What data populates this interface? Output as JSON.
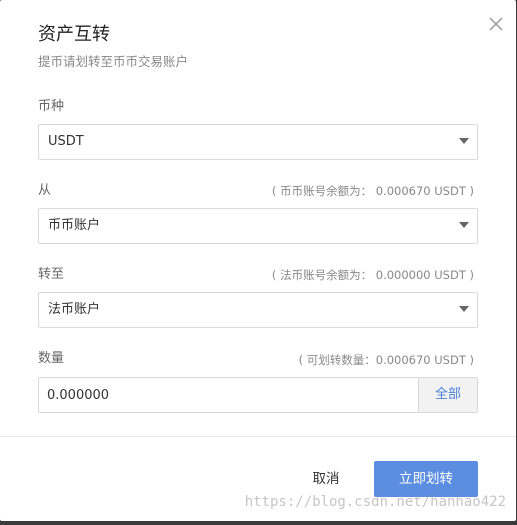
{
  "dialog": {
    "title": "资产互转",
    "subtitle": "提币请划转至币币交易账户"
  },
  "currency": {
    "label": "币种",
    "value": "USDT"
  },
  "from": {
    "label": "从",
    "hint": "( 币币账号余额为： 0.000670 USDT )",
    "value": "币币账户"
  },
  "to": {
    "label": "转至",
    "hint": "( 法币账号余额为： 0.000000 USDT )",
    "value": "法币账户"
  },
  "amount": {
    "label": "数量",
    "hint": "( 可划转数量：0.000670 USDT )",
    "value": "0.000000",
    "all_label": "全部"
  },
  "footer": {
    "cancel_label": "取消",
    "confirm_label": "立即划转"
  },
  "watermark": "https://blog.csdn.net/hanhao422",
  "colors": {
    "primary": "#5b8ee0",
    "link": "#4a7fd6",
    "border": "#d9d9d9"
  },
  "icons": {
    "close": "close-icon",
    "dropdown": "chevron-down-icon"
  }
}
